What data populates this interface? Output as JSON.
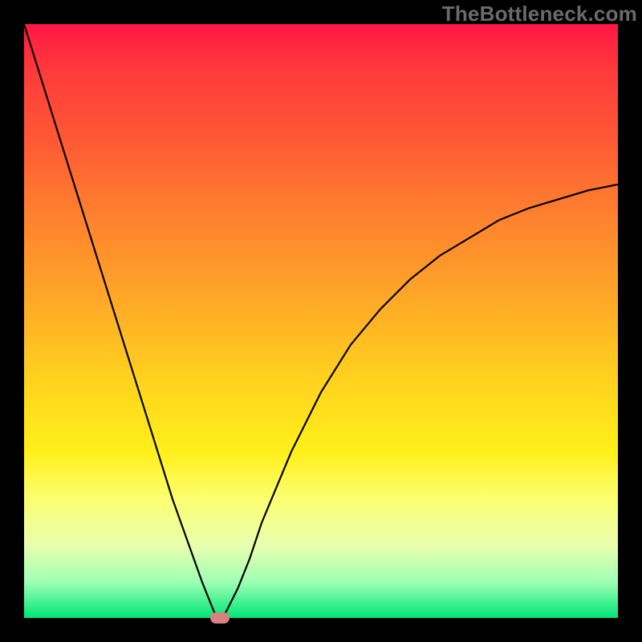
{
  "watermark": "TheBottleneck.com",
  "chart_data": {
    "type": "line",
    "title": "",
    "xlabel": "",
    "ylabel": "",
    "xlim": [
      0,
      100
    ],
    "ylim": [
      0,
      100
    ],
    "grid": false,
    "legend": false,
    "series": [
      {
        "name": "curve",
        "x": [
          0,
          5,
          10,
          15,
          20,
          25,
          30,
          32,
          33,
          34,
          36,
          38,
          40,
          45,
          50,
          55,
          60,
          65,
          70,
          75,
          80,
          85,
          90,
          95,
          100
        ],
        "y": [
          100,
          84,
          68,
          52,
          36,
          20,
          6,
          1,
          0,
          1,
          5,
          10,
          16,
          28,
          38,
          46,
          52,
          57,
          61,
          64,
          67,
          69,
          70.5,
          72,
          73
        ]
      }
    ],
    "min_marker": {
      "x": 33,
      "y": 0
    }
  }
}
